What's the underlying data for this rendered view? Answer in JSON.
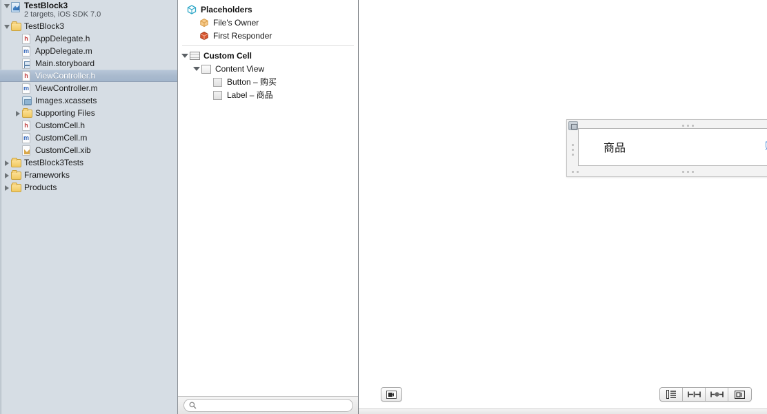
{
  "navigator": {
    "project": {
      "name": "TestBlock3",
      "subtitle": "2 targets, iOS SDK 7.0",
      "icon": "project-icon"
    },
    "items": [
      {
        "label": "TestBlock3",
        "icon": "folder-icon",
        "indent": 1,
        "twisty": "open",
        "selected": false
      },
      {
        "label": "AppDelegate.h",
        "icon": "header-file-icon",
        "indent": 2,
        "twisty": "none",
        "selected": false
      },
      {
        "label": "AppDelegate.m",
        "icon": "source-file-icon",
        "indent": 2,
        "twisty": "none",
        "selected": false
      },
      {
        "label": "Main.storyboard",
        "icon": "storyboard-icon",
        "indent": 2,
        "twisty": "none",
        "selected": false
      },
      {
        "label": "ViewController.h",
        "icon": "header-file-icon",
        "indent": 2,
        "twisty": "none",
        "selected": true
      },
      {
        "label": "ViewController.m",
        "icon": "source-file-icon",
        "indent": 2,
        "twisty": "none",
        "selected": false
      },
      {
        "label": "Images.xcassets",
        "icon": "assets-icon",
        "indent": 2,
        "twisty": "none",
        "selected": false
      },
      {
        "label": "Supporting Files",
        "icon": "folder-icon",
        "indent": 2,
        "twisty": "closed",
        "selected": false
      },
      {
        "label": "CustomCell.h",
        "icon": "header-file-icon",
        "indent": 2,
        "twisty": "none",
        "selected": false
      },
      {
        "label": "CustomCell.m",
        "icon": "source-file-icon",
        "indent": 2,
        "twisty": "none",
        "selected": false
      },
      {
        "label": "CustomCell.xib",
        "icon": "xib-file-icon",
        "indent": 2,
        "twisty": "none",
        "selected": false
      },
      {
        "label": "TestBlock3Tests",
        "icon": "folder-icon",
        "indent": 1,
        "twisty": "closed",
        "selected": false
      },
      {
        "label": "Frameworks",
        "icon": "folder-icon",
        "indent": 1,
        "twisty": "closed",
        "selected": false
      },
      {
        "label": "Products",
        "icon": "folder-icon",
        "indent": 1,
        "twisty": "closed",
        "selected": false
      }
    ]
  },
  "outline": {
    "placeholders": {
      "label": "Placeholders",
      "icon": "cube-cyan-icon",
      "children": [
        {
          "label": "File's Owner",
          "icon": "cube-orange-icon"
        },
        {
          "label": "First Responder",
          "icon": "cube-red-icon"
        }
      ]
    },
    "objects": {
      "label": "Custom Cell",
      "icon": "table-cell-icon",
      "content_view": {
        "label": "Content View",
        "icon": "view-icon"
      },
      "subviews": [
        {
          "label": "Button – 购买",
          "icon": "button-icon"
        },
        {
          "label": "Label – 商品",
          "icon": "label-icon"
        }
      ]
    },
    "search": {
      "placeholder": "",
      "icon": "search-icon"
    }
  },
  "canvas": {
    "cell": {
      "title": "商品",
      "action": "购买",
      "action_color": "#2f7bd1",
      "badge_icon": "constraints-badge-icon"
    },
    "bottom_bar": {
      "outline_toggle": {
        "icon": "hide-document-outline-icon",
        "title": "Hide Document Outline"
      },
      "segments": [
        {
          "icon": "document-outline-icon",
          "title": "Show Document Outline"
        },
        {
          "icon": "align-icon",
          "title": "Align"
        },
        {
          "icon": "pin-icon",
          "title": "Pin"
        },
        {
          "icon": "resolve-issues-icon",
          "title": "Resolve Auto Layout Issues"
        }
      ]
    }
  }
}
